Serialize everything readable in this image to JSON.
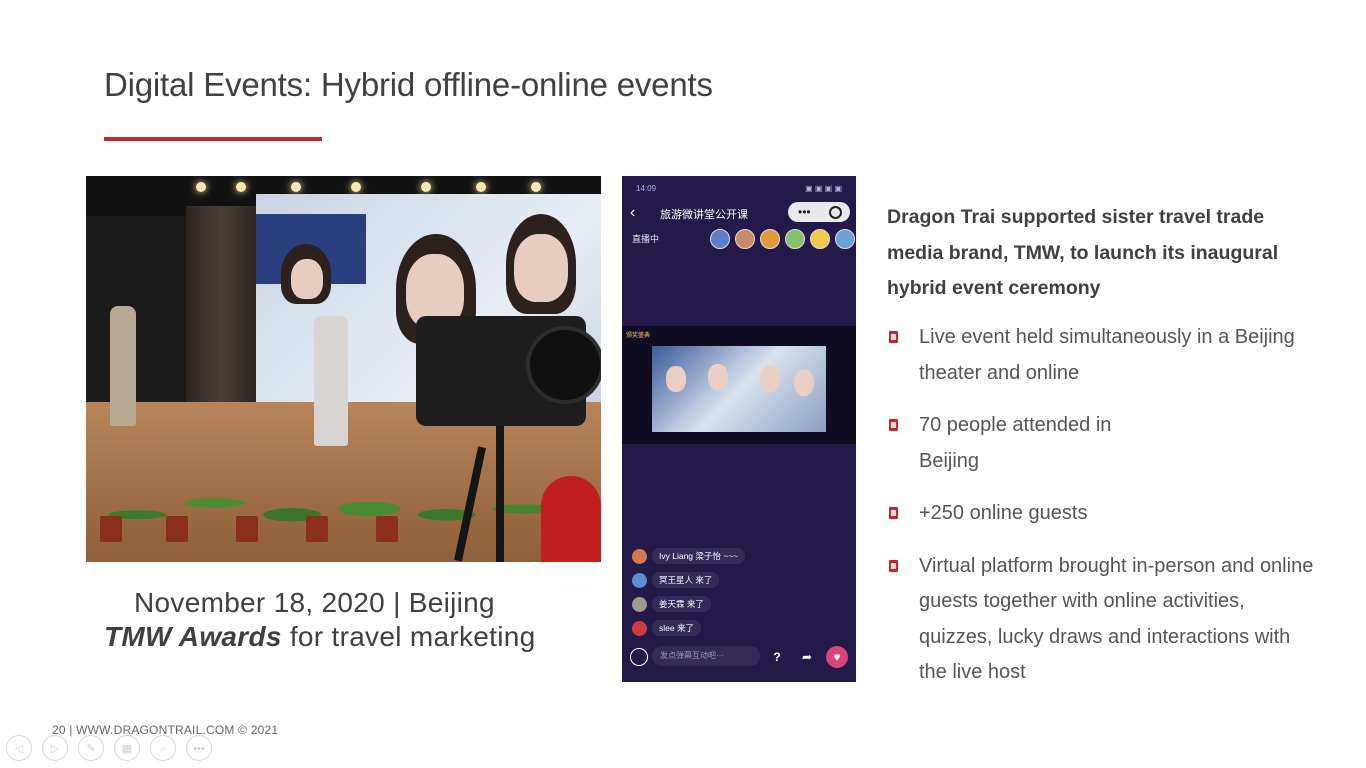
{
  "slide": {
    "title": "Digital Events: Hybrid offline-online events",
    "accent_color": "#c0292d"
  },
  "caption": {
    "line1": "November 18, 2020 | Beijing",
    "line2_bold": "TMW Awards",
    "line2_rest": " for travel marketing"
  },
  "phone": {
    "status_time": "14:09",
    "status_icons": "▣ ▣ ▣ ▣",
    "title": "旅游微讲堂公开课",
    "capsule_dots": "•••",
    "live_label": "直播中",
    "video_label": "颁奖盛典",
    "comments": [
      {
        "text": "Ivy Liang 梁子怡 ~~~"
      },
      {
        "text": "冥王星人 来了"
      },
      {
        "text": "姜天霖 来了"
      },
      {
        "text": "slee 来了"
      }
    ],
    "input_placeholder": "发点弹幕互动吧···",
    "btn_question": "?",
    "btn_share": "➦",
    "btn_like": "♥"
  },
  "text": {
    "lead": "Dragon Trai supported sister travel trade media brand, TMW, to launch its inaugural hybrid event ceremony",
    "bullets": [
      "Live event held simultaneously in a Beijing theater and online",
      "70 people attended in Beijing",
      "+250 online guests",
      "Virtual platform brought in-person and online guests together with online activities, quizzes, lucky draws and interactions with the live host"
    ]
  },
  "footer": {
    "text": "20  | WWW.DRAGONTRAIL.COM ©  2021"
  },
  "controls": {
    "prev": "◁",
    "next": "▷",
    "pen": "✎",
    "slides": "▦",
    "zoom": "⌕",
    "more": "•••"
  }
}
